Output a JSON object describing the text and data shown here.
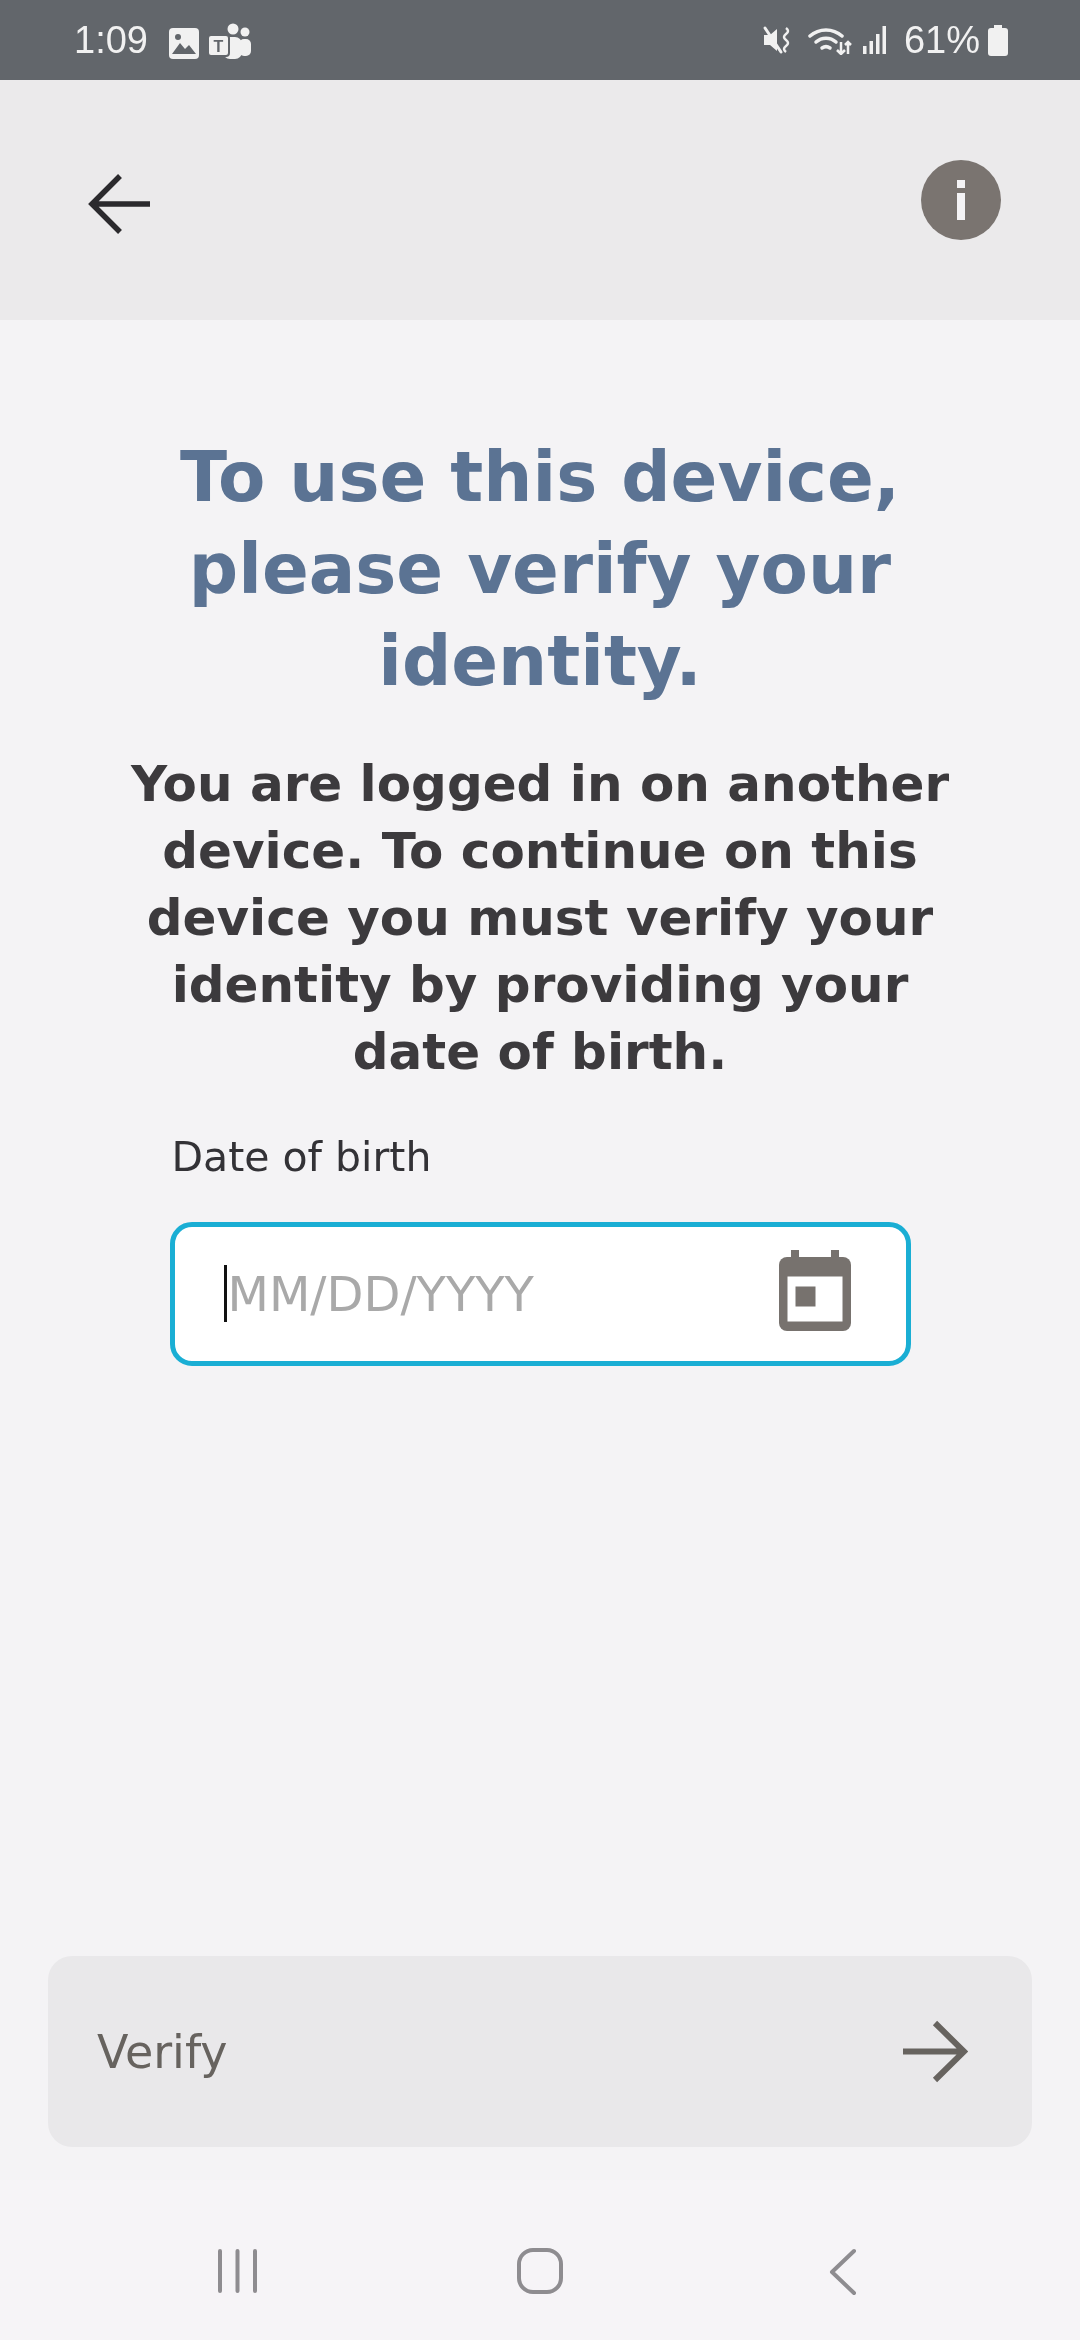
{
  "status_bar": {
    "time": "1:09",
    "notifications": [
      {
        "kind": "gallery"
      },
      {
        "kind": "teams",
        "letter": "T"
      }
    ],
    "battery": "61%"
  },
  "title": "To use this device, please verify your identity.",
  "message": "You are logged in on another device. To continue on this device you must verify your identity by providing your date of birth.",
  "date_field": {
    "label": "Date of birth",
    "placeholder": "MM/DD/YYYY",
    "focused": true
  },
  "verify_button": {
    "label": "Verify",
    "disabled": true
  }
}
